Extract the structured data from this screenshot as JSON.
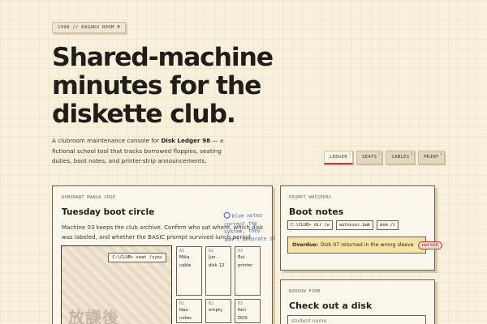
{
  "header": {
    "chip": "1998 // KAGAKU ROOM B",
    "title": "Shared-machine minutes for the diskette club.",
    "intro_prefix": "A clubroom maintenance console for ",
    "intro_strong": "Disk Ledger 98",
    "intro_suffix": " — a fictional school tool that tracks borrowed floppies, seating duties, boot notes, and printer-strip announcements."
  },
  "tabs": [
    {
      "label": "LEDGER",
      "sup": "1",
      "active": true
    },
    {
      "label": "SEATS",
      "sup": "2",
      "active": false
    },
    {
      "label": "CABLES",
      "sup": "3",
      "active": false
    },
    {
      "label": "PRINT",
      "sup": "4",
      "active": false
    }
  ],
  "main": {
    "kicker": "DOMINANT MANGA CROP",
    "title": "Tuesday boot circle",
    "description": "Machine 03 keeps the club archive. Confirm who sat where, which disk was labeled, and whether the BASIC prompt survived lunch period.",
    "screen_tag": "C:\\CLUB> seat /sync",
    "screen_kanji": "放課後",
    "seats": [
      {
        "id": "A1",
        "name": "Mika · cable"
      },
      {
        "id": "A2",
        "name": "Jun · disk 12"
      },
      {
        "id": "A3",
        "name": "Rui · printer"
      },
      {
        "id": "B1",
        "name": "Nao · notes"
      },
      {
        "id": "B2",
        "name": "empty"
      },
      {
        "id": "B3",
        "name": "Ken · DOS"
      }
    ]
  },
  "note": "blue notes correct the system, they don't decorate it",
  "boot": {
    "kicker": "PROMPT WHISPERS",
    "title": "Boot notes",
    "commands": [
      "C:\\CLUB> dir /w",
      "autoexec.bak",
      "mem /c"
    ],
    "overdue_label": "Overdue:",
    "overdue_text": "Disk 07 returned in the wrong sleeve",
    "badge": "red tick"
  },
  "borrow": {
    "kicker": "BORROW FORM",
    "title": "Check out a disk",
    "input_placeholder": "student name"
  }
}
